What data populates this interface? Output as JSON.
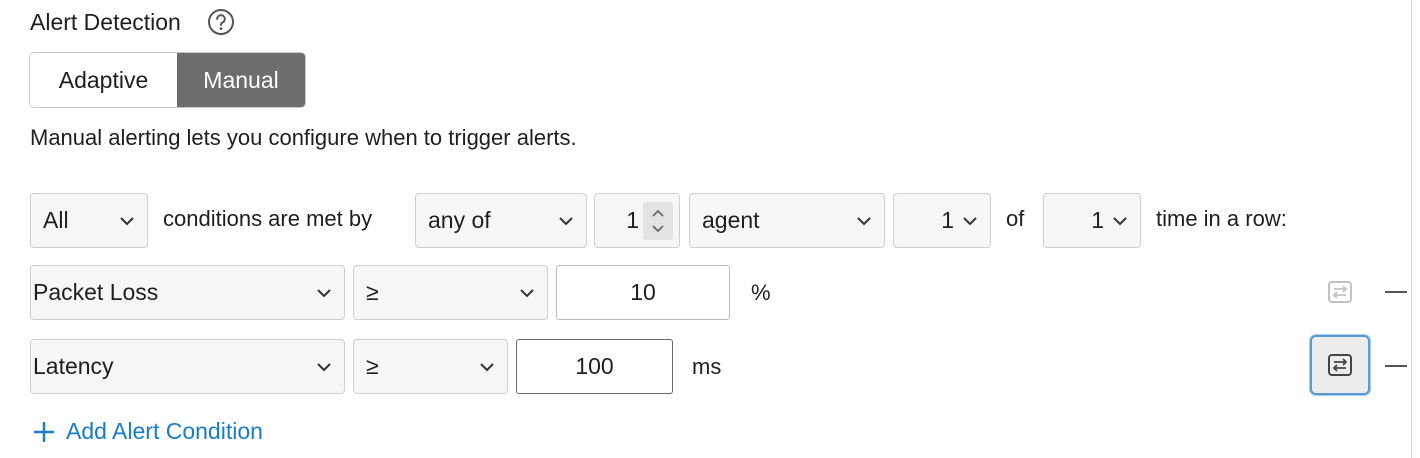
{
  "alert_detection": {
    "title": "Alert Detection",
    "help_icon": "question-circle-icon",
    "modes": [
      "Adaptive",
      "Manual"
    ],
    "selected_mode": "Manual",
    "description": "Manual alerting lets you configure when to trigger alerts."
  },
  "rule": {
    "match_select": "All",
    "conditions_text": "conditions are met by",
    "scope_select": "any of",
    "count_value": "1",
    "target_select": "agent",
    "times_select": "1",
    "of_text": "of",
    "window_select": "1",
    "suffix_text": "time in a row:"
  },
  "conditions": [
    {
      "metric": "Packet Loss",
      "operator": "≥",
      "value": "10",
      "unit": "%"
    },
    {
      "metric": "Latency",
      "operator": "≥",
      "value": "100",
      "unit": "ms"
    }
  ],
  "add_condition_label": "Add Alert Condition",
  "colors": {
    "accent_blue": "#1a7bc8",
    "selected_segment": "#6d6d6d",
    "focus_ring": "#5b9bd5"
  }
}
